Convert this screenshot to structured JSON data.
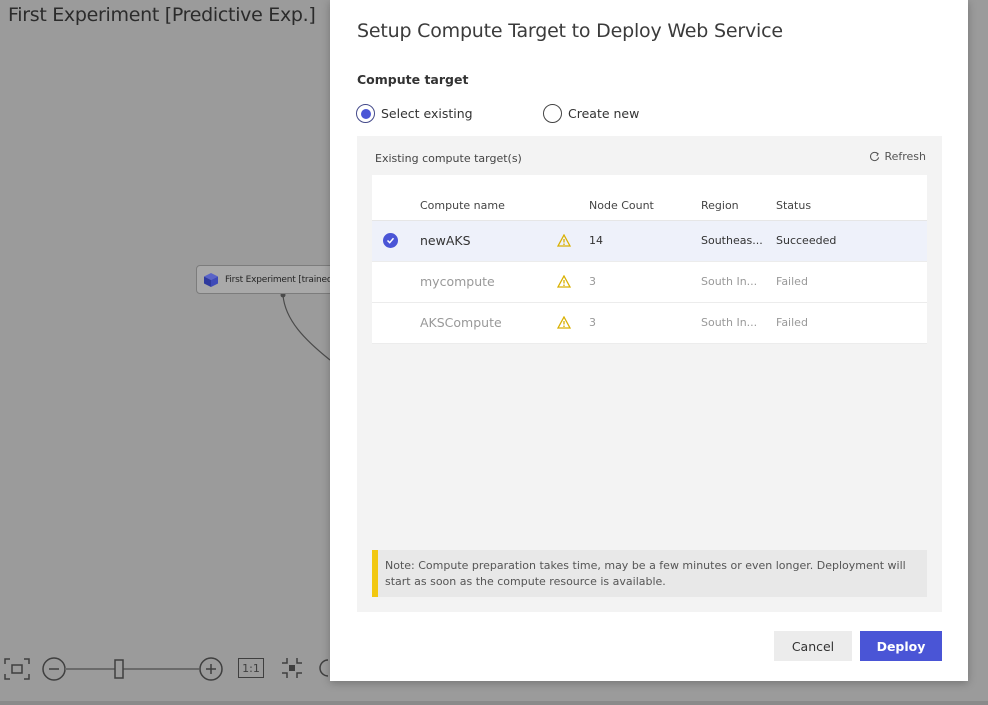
{
  "background": {
    "experiment_title": "First Experiment [Predictive Exp.]",
    "node_label": "First Experiment [trained mo",
    "zoom_reset_label": "1:1"
  },
  "dialog": {
    "title": "Setup Compute Target to Deploy Web Service",
    "section_label": "Compute target",
    "radio_options": [
      {
        "label": "Select existing",
        "checked": true
      },
      {
        "label": "Create new",
        "checked": false
      }
    ],
    "panel_label": "Existing compute target(s)",
    "refresh_label": "Refresh",
    "columns": {
      "name": "Compute name",
      "node_count": "Node Count",
      "region": "Region",
      "status": "Status"
    },
    "rows": [
      {
        "name": "newAKS",
        "node_count": "14",
        "region": "Southeas...",
        "status": "Succeeded",
        "selected": true,
        "warning": true
      },
      {
        "name": "mycompute",
        "node_count": "3",
        "region": "South In...",
        "status": "Failed",
        "selected": false,
        "warning": true
      },
      {
        "name": "AKSCompute",
        "node_count": "3",
        "region": "South In...",
        "status": "Failed",
        "selected": false,
        "warning": true
      }
    ],
    "note": "Note: Compute preparation takes time, may be a few minutes or even longer. Deployment will start as soon as the compute resource is available.",
    "cancel_label": "Cancel",
    "deploy_label": "Deploy"
  },
  "colors": {
    "accent": "#4a55d6",
    "warning": "#f2c811",
    "overlay": "#9b9b9b"
  }
}
